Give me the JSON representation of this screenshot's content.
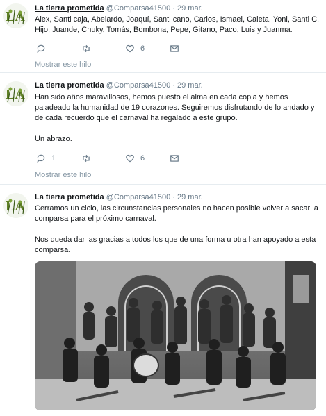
{
  "tweets": [
    {
      "name": "La tierra prometida",
      "handle": "@Comparsa41500",
      "sep": "·",
      "date": "29 mar.",
      "paragraphs": [
        "Alex, Santi caja, Abelardo, Joaquí, Santi cano, Carlos, Ismael, Caleta, Yoni, Santi C. Hijo, Juande, Chuky, Tomás, Bombona, Pepe, Gitano, Paco, Luis y Juanma."
      ],
      "reply_count": "",
      "retweet_count": "",
      "like_count": "6",
      "show_thread": "Mostrar este hilo"
    },
    {
      "name": "La tierra prometida",
      "handle": "@Comparsa41500",
      "sep": "·",
      "date": "29 mar.",
      "paragraphs": [
        "Han sido años maravillosos, hemos puesto el alma en cada copla y hemos paladeado la humanidad de 19 corazones. Seguiremos disfrutando de lo andado y de cada recuerdo que el carnaval ha regalado a este grupo.",
        "Un abrazo."
      ],
      "reply_count": "1",
      "retweet_count": "",
      "like_count": "6",
      "show_thread": "Mostrar este hilo"
    },
    {
      "name": "La tierra prometida",
      "handle": "@Comparsa41500",
      "sep": "·",
      "date": "29 mar.",
      "paragraphs": [
        "Cerramos un ciclo, las circunstancias personales no hacen posible volver a sacar la comparsa para el próximo carnaval.",
        "Nos queda dar las gracias a todos los que de una forma u otra han apoyado a esta comparsa."
      ]
    }
  ],
  "icons": {
    "avatar": "comparsa-logo-icon",
    "reply": "reply-icon",
    "retweet": "retweet-icon",
    "like": "heart-icon",
    "message": "envelope-icon"
  },
  "colors": {
    "secondary_text": "#657786",
    "divider": "#e6ecf0",
    "avatar_green": "#6b8f2a"
  }
}
